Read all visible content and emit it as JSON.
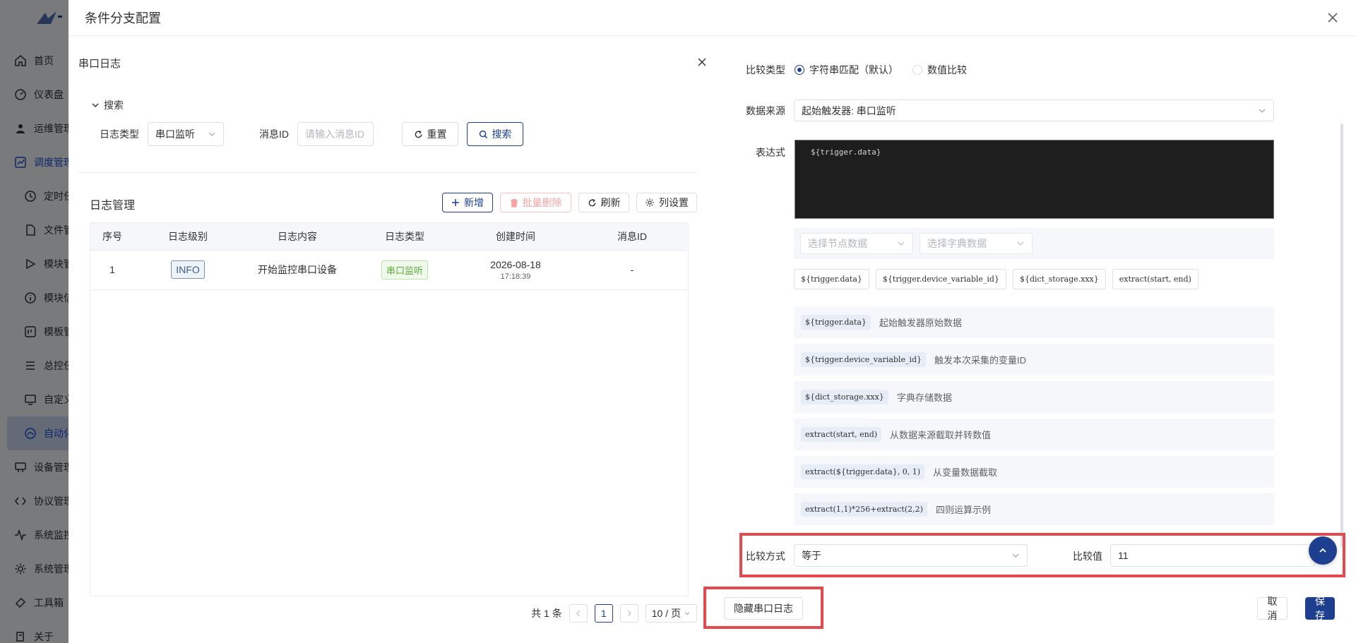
{
  "bg_nav": [
    {
      "label": "首页",
      "icon": "home-icon",
      "sub": false
    },
    {
      "label": "仪表盘",
      "icon": "dashboard-icon",
      "sub": false
    },
    {
      "label": "运维管理",
      "icon": "user-icon",
      "sub": false
    },
    {
      "label": "调度管理",
      "icon": "schedule-icon",
      "sub": false,
      "parent_active": true
    },
    {
      "label": "定时任务",
      "icon": "clock-icon",
      "sub": true
    },
    {
      "label": "文件管理",
      "icon": "file-icon",
      "sub": true
    },
    {
      "label": "模块管理",
      "icon": "play-icon",
      "sub": true
    },
    {
      "label": "模块信息",
      "icon": "info-icon",
      "sub": true
    },
    {
      "label": "模板管理",
      "icon": "template-icon",
      "sub": true
    },
    {
      "label": "总控任务",
      "icon": "list-icon",
      "sub": true
    },
    {
      "label": "自定义",
      "icon": "monitor-icon",
      "sub": true
    },
    {
      "label": "自动化",
      "icon": "automation-icon",
      "sub": true,
      "active": true
    },
    {
      "label": "设备管理",
      "icon": "device-icon",
      "sub": false
    },
    {
      "label": "协议管理",
      "icon": "code-icon",
      "sub": false
    },
    {
      "label": "系统监控",
      "icon": "pulse-icon",
      "sub": false
    },
    {
      "label": "系统管理",
      "icon": "gear-icon",
      "sub": false
    },
    {
      "label": "工具箱",
      "icon": "toolbox-icon",
      "sub": false
    },
    {
      "label": "关于",
      "icon": "about-icon",
      "sub": false
    }
  ],
  "drawer": {
    "title": "条件分支配置"
  },
  "serial_log": {
    "title": "串口日志",
    "search_toggle": "搜索",
    "log_type_label": "日志类型",
    "log_type_value": "串口监听",
    "msg_id_label": "消息ID",
    "msg_id_placeholder": "请输入消息ID",
    "reset_label": "重置",
    "search_label": "搜索",
    "manage_title": "日志管理",
    "add_label": "新增",
    "batch_delete_label": "批量删除",
    "refresh_label": "刷新",
    "columns_label": "列设置",
    "table": {
      "headers": [
        "序号",
        "日志级别",
        "日志内容",
        "日志类型",
        "创建时间",
        "消息ID"
      ],
      "rows": [
        {
          "index": "1",
          "level": "INFO",
          "content": "开始监控串口设备",
          "type": "串口监听",
          "date": "2026-08-18",
          "time": "17:18:39",
          "msg_id": "-"
        }
      ]
    },
    "pager": {
      "total": "共 1 条",
      "page": "1",
      "size": "10 / 页"
    }
  },
  "config": {
    "compare_type_label": "比较类型",
    "radio_string": "字符串匹配（默认）",
    "radio_number": "数值比较",
    "source_label": "数据来源",
    "source_value": "起始触发器: 串口监听",
    "expression_label": "表达式",
    "expression_value": "${trigger.data}",
    "node_select_placeholder": "选择节点数据",
    "dict_select_placeholder": "选择字典数据",
    "chips": [
      "${trigger.data}",
      "${trigger.device_variable_id}",
      "${dict_storage.xxx}",
      "extract(start, end)"
    ],
    "references": [
      {
        "code": "${trigger.data}",
        "desc": "起始触发器原始数据"
      },
      {
        "code": "${trigger.device_variable_id}",
        "desc": "触发本次采集的变量ID"
      },
      {
        "code": "${dict_storage.xxx}",
        "desc": "字典存储数据"
      },
      {
        "code": "extract(start, end)",
        "desc": "从数据来源截取并转数值"
      },
      {
        "code": "extract(${trigger.data}, 0, 1)",
        "desc": "从变量数据截取"
      },
      {
        "code": "extract(1,1)*256+extract(2,2)",
        "desc": "四则运算示例"
      }
    ],
    "compare_method_label": "比较方式",
    "compare_method_value": "等于",
    "compare_value_label": "比较值",
    "compare_value": "11",
    "hide_log_label": "隐藏串口日志",
    "cancel_label": "取消",
    "save_label": "保存"
  },
  "colors": {
    "primary": "#1e3f8f",
    "highlight_box": "#e5484d",
    "success_tag": "#58b03a"
  }
}
